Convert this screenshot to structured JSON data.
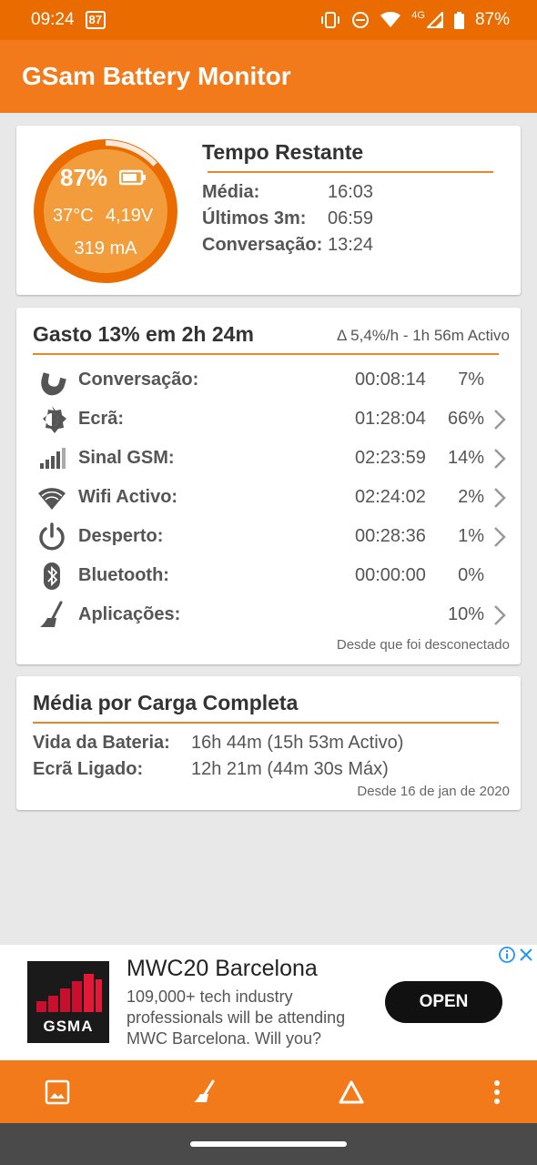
{
  "status_bar": {
    "time": "09:24",
    "badge": "87",
    "network": "4G",
    "battery": "87%"
  },
  "app_bar": {
    "title": "GSam Battery Monitor"
  },
  "gauge": {
    "percent": "87%",
    "level": 0.87,
    "temperature": "37°C",
    "voltage": "4,19V",
    "current": "319 mA"
  },
  "remaining": {
    "title": "Tempo Restante",
    "rows": [
      {
        "label": "Média:",
        "value": "16:03"
      },
      {
        "label": "Últimos 3m:",
        "value": "06:59"
      },
      {
        "label": "Conversação:",
        "value": "13:24"
      }
    ]
  },
  "usage": {
    "title": "Gasto 13% em 2h 24m",
    "subtitle": "Δ 5,4%/h - 1h 56m Activo",
    "rows": [
      {
        "icon": "phone-icon",
        "label": "Conversação:",
        "time": "00:08:14",
        "pct": "7%",
        "chevron": false
      },
      {
        "icon": "brightness-icon",
        "label": "Ecrã:",
        "time": "01:28:04",
        "pct": "66%",
        "chevron": true
      },
      {
        "icon": "signal-icon",
        "label": "Sinal GSM:",
        "time": "02:23:59",
        "pct": "14%",
        "chevron": true
      },
      {
        "icon": "wifi-icon",
        "label": "Wifi Activo:",
        "time": "02:24:02",
        "pct": "2%",
        "chevron": true
      },
      {
        "icon": "power-icon",
        "label": "Desperto:",
        "time": "00:28:36",
        "pct": "1%",
        "chevron": true
      },
      {
        "icon": "bluetooth-icon",
        "label": "Bluetooth:",
        "time": "00:00:00",
        "pct": "0%",
        "chevron": false
      },
      {
        "icon": "broom-icon",
        "label": "Aplicações:",
        "time": "",
        "pct": "10%",
        "chevron": true
      }
    ],
    "footer": "Desde que foi desconectado"
  },
  "full_charge": {
    "title": "Média por Carga Completa",
    "rows": [
      {
        "label": "Vida da Bateria:",
        "value": "16h 44m (15h 53m Activo)"
      },
      {
        "label": "Ecrã Ligado:",
        "value": "12h 21m (44m 30s Máx)"
      }
    ],
    "footer": "Desde 16 de jan de 2020"
  },
  "ad": {
    "logo_text": "GSMA",
    "title": "MWC20 Barcelona",
    "body": "109,000+ tech industry professionals will be attending MWC Barcelona. Will you?",
    "button": "OPEN"
  },
  "colors": {
    "primary": "#f27a1a",
    "status_bar": "#ea6c00",
    "accent_line": "#e8862a"
  }
}
